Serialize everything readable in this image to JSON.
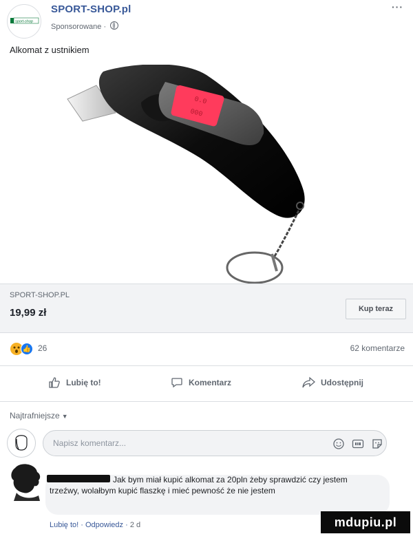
{
  "header": {
    "page_name": "SPORT-SHOP.pl",
    "sponsored_label": "Sponsorowane · ",
    "more_label": "···",
    "logo_text": "sport-shop"
  },
  "post": {
    "text": "Alkomat z ustnikiem"
  },
  "media": {
    "description_icon": "breathalyzer-image",
    "display_text": [
      "0.0",
      "000"
    ]
  },
  "link_preview": {
    "domain": "SPORT-SHOP.PL",
    "price": "19,99 zł",
    "cta_label": "Kup teraz"
  },
  "stats": {
    "reaction_count": "26",
    "comments_count": "62 komentarze"
  },
  "actions": {
    "like_label": "Lubię to!",
    "comment_label": "Komentarz",
    "share_label": "Udostępnij"
  },
  "comments": {
    "sort_label": "Najtrafniejsze",
    "input_placeholder": "Napisz komentarz...",
    "items": [
      {
        "text": "Jak bym miał kupić alkomat za 20pln żeby sprawdzić czy jestem trzeźwy, wolałbym kupić flaszkę i mieć pewność że nie jestem",
        "like_link": "Lubię to!",
        "reply_link": "Odpowiedz",
        "time": "2 d"
      }
    ]
  },
  "watermark": {
    "text": "mdupiu.pl"
  },
  "colors": {
    "link_blue": "#385898",
    "like_blue": "#1877f2",
    "bar_gray": "#f2f3f5"
  }
}
